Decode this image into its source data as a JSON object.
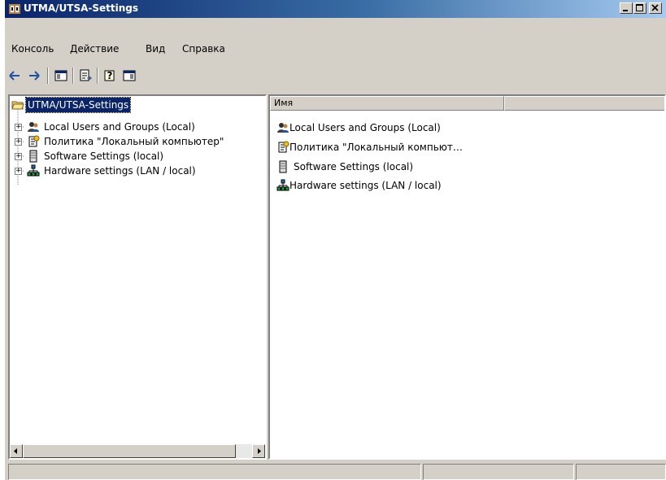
{
  "window": {
    "title": "UTMA/UTSA-Settings",
    "controls": [
      "minimize-icon",
      "maximize-icon",
      "close-icon"
    ]
  },
  "menu": {
    "items": [
      {
        "label": "Консоль"
      },
      {
        "label": "Действие"
      },
      {
        "label": "Вид"
      },
      {
        "label": "Справка"
      }
    ]
  },
  "toolbar": {
    "buttons": [
      "back-arrow-icon",
      "forward-arrow-icon",
      "show-hide-tree-icon",
      "export-list-icon",
      "help-icon",
      "action-pane-icon"
    ]
  },
  "tree": {
    "root": {
      "label": "UTMA/UTSA-Settings",
      "icon": "folder-open-icon"
    },
    "children": [
      {
        "label": "Local Users and Groups (Local)",
        "icon": "users-icon"
      },
      {
        "label": "Политика \"Локальный компьютер\"",
        "icon": "policy-icon"
      },
      {
        "label": "Software Settings (local)",
        "icon": "server-icon"
      },
      {
        "label": "Hardware settings (LAN / local)",
        "icon": "network-icon"
      }
    ]
  },
  "list": {
    "columns": [
      {
        "label": "Имя"
      },
      {
        "label": ""
      }
    ],
    "items": [
      {
        "label": "Local Users and Groups (Local)",
        "icon": "users-icon"
      },
      {
        "label": "Политика \"Локальный компьют…",
        "icon": "policy-icon"
      },
      {
        "label": "Software Settings (local)",
        "icon": "server-icon"
      },
      {
        "label": "Hardware settings (LAN / local)",
        "icon": "network-icon"
      }
    ]
  },
  "colors": {
    "titlebar_start": "#0a246a",
    "titlebar_end": "#a6caf0",
    "face": "#d4d0c8",
    "selection": "#0a246a"
  }
}
